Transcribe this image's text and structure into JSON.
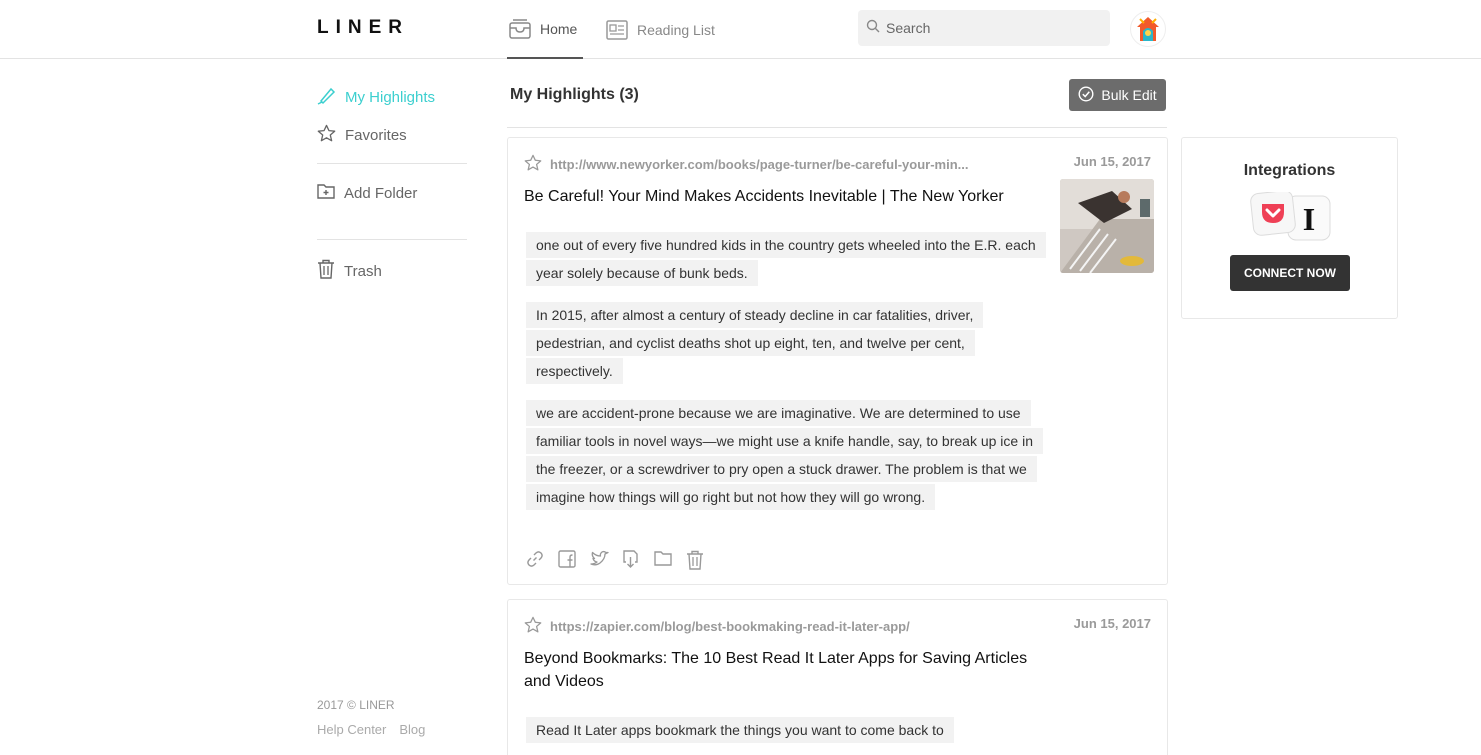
{
  "app": {
    "logo": "LINER"
  },
  "nav": {
    "tabs": [
      {
        "label": "Home",
        "icon": "inbox-icon",
        "active": true
      },
      {
        "label": "Reading List",
        "icon": "reading-list-icon",
        "active": false
      }
    ]
  },
  "search": {
    "placeholder": "Search"
  },
  "sidebar": {
    "items": [
      {
        "label": "My Highlights",
        "icon": "highlighter-icon",
        "active": true
      },
      {
        "label": "Favorites",
        "icon": "star-icon"
      },
      {
        "label": "Add Folder",
        "icon": "add-folder-icon"
      },
      {
        "label": "Trash",
        "icon": "trash-icon"
      }
    ],
    "footer": {
      "copyright": "2017 © LINER",
      "links": [
        "Help Center",
        "Blog"
      ]
    }
  },
  "main": {
    "title": "My Highlights (3)",
    "bulk_edit_label": "Bulk Edit",
    "cards": [
      {
        "url": "http://www.newyorker.com/books/page-turner/be-careful-your-min...",
        "date": "Jun 15, 2017",
        "title": "Be Careful! Your Mind Makes Accidents Inevitable | The New Yorker",
        "highlights": [
          "one out of every five hundred kids in the country gets wheeled into the E.R. each year solely because of bunk beds.",
          "In 2015, after almost a century of steady decline in car fatalities, driver, pedestrian, and cyclist deaths shot up eight, ten, and twelve per cent, respectively.",
          "we are accident-prone because we are imaginative. We are determined to use familiar tools in novel ways—we might use a knife handle, say, to break up ice in the freezer, or a screwdriver to pry open a stuck drawer. The problem is that we imagine how things will go right but not how they will go wrong."
        ],
        "actions": [
          "link-icon",
          "facebook-icon",
          "twitter-icon",
          "download-icon",
          "folder-icon",
          "trash-icon"
        ]
      },
      {
        "url": "https://zapier.com/blog/best-bookmaking-read-it-later-app/",
        "date": "Jun 15, 2017",
        "title": "Beyond Bookmarks: The 10 Best Read It Later Apps for Saving Articles and Videos",
        "highlights": [
          "Read It Later apps bookmark the things you want to come back to"
        ]
      }
    ]
  },
  "integrations": {
    "title": "Integrations",
    "connect_label": "CONNECT NOW",
    "icons": [
      "pocket-icon",
      "instapaper-icon"
    ]
  },
  "colors": {
    "accent": "#3ccfcf",
    "button_dark": "#333333",
    "bulk_edit_bg": "#6c6c6c"
  }
}
